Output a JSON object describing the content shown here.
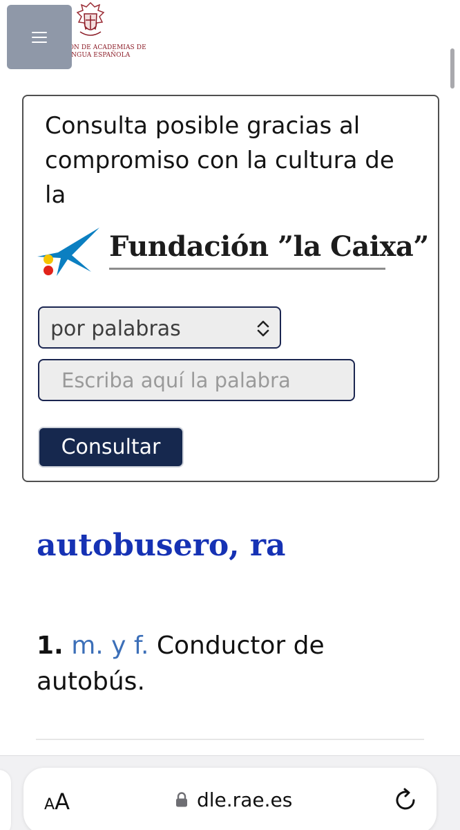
{
  "header": {
    "menu_icon": "hamburger-menu-icon",
    "logo_text": "ASOCIACIÓN DE ACADEMIAS DE LA LENGUA ESPAÑOLA",
    "logo_color": "#8b1b26"
  },
  "search": {
    "sponsor_text": "Consulta posible gracias al compromiso con la cultura de la",
    "sponsor_logo_text": "Fundación ”la Caixa”",
    "mode_select_value": "por palabras",
    "input_placeholder": "Escriba aquí la palabra",
    "submit_label": "Consultar",
    "submit_color": "#16284e"
  },
  "entry": {
    "headword": "autobusero, ra",
    "headword_color": "#1632b4",
    "definitions": [
      {
        "number": "1.",
        "abbr": "m. y f.",
        "text": "Conductor de autobús."
      }
    ]
  },
  "browser": {
    "text_size_small": "A",
    "text_size_big": "A",
    "url": "dle.rae.es",
    "lock_icon": "lock-icon",
    "reload_icon": "reload-icon"
  }
}
